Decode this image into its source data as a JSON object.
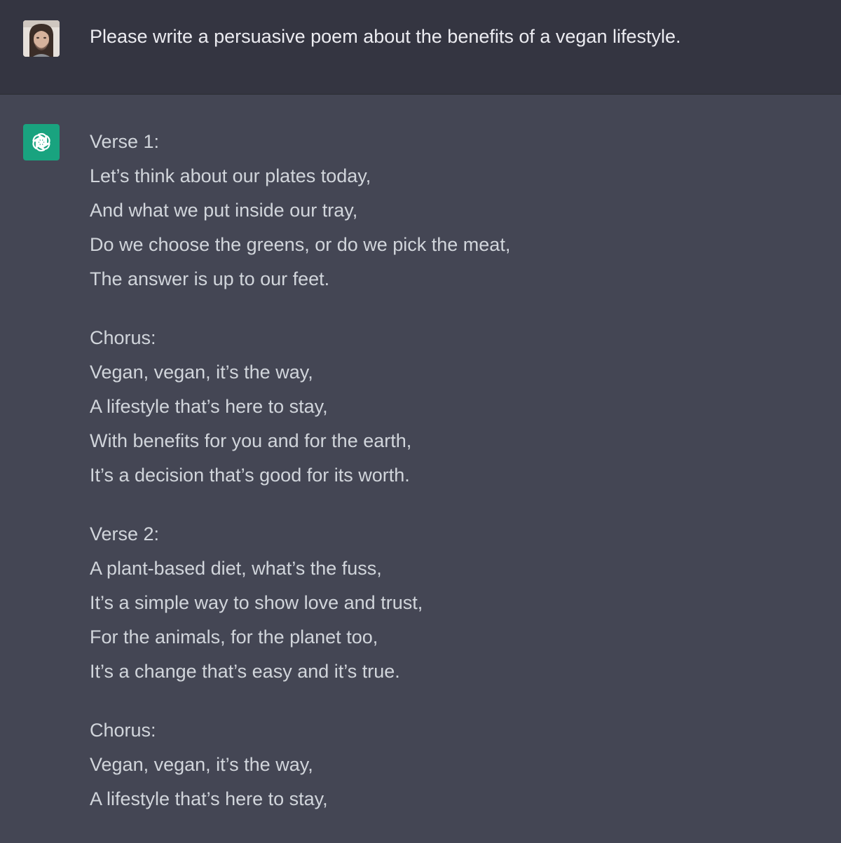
{
  "user_message": {
    "avatar": "user-avatar-photo",
    "text": "Please write a persuasive poem about the benefits of a vegan lifestyle."
  },
  "assistant_message": {
    "icon": "openai-logo-icon",
    "accent_color": "#19a37f",
    "stanzas": [
      {
        "heading": "Verse 1:",
        "lines": [
          "Let’s think about our plates today,",
          "And what we put inside our tray,",
          "Do we choose the greens, or do we pick the meat,",
          "The answer is up to our feet."
        ]
      },
      {
        "heading": "Chorus:",
        "lines": [
          "Vegan, vegan, it’s the way,",
          "A lifestyle that’s here to stay,",
          "With benefits for you and for the earth,",
          "It’s a decision that’s good for its worth."
        ]
      },
      {
        "heading": "Verse 2:",
        "lines": [
          "A plant-based diet, what’s the fuss,",
          "It’s a simple way to show love and trust,",
          "For the animals, for the planet too,",
          "It’s a change that’s easy and it’s true."
        ]
      },
      {
        "heading": "Chorus:",
        "lines": [
          "Vegan, vegan, it’s the way,",
          "A lifestyle that’s here to stay,"
        ]
      }
    ]
  }
}
